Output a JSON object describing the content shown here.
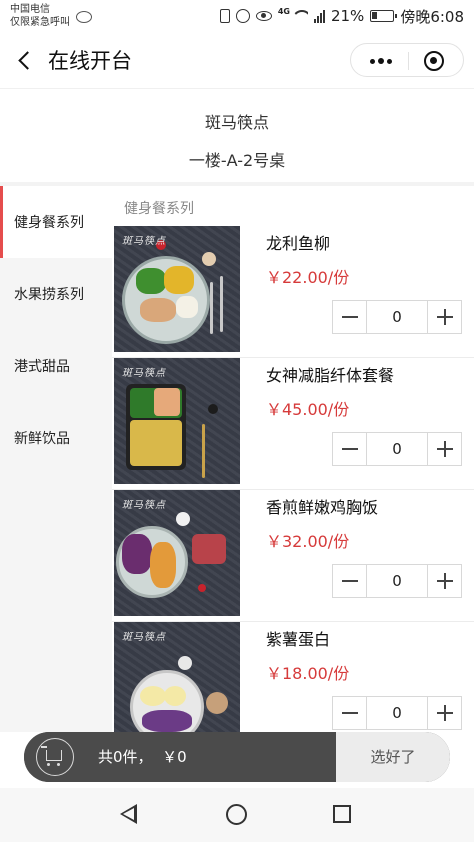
{
  "status_bar": {
    "carrier_line1": "中国电信",
    "carrier_line2": "仅限紧急呼叫",
    "network": "4G",
    "battery": "21%",
    "time": "傍晚6:08"
  },
  "navbar": {
    "title": "在线开台"
  },
  "shop": {
    "name": "斑马筷点",
    "table": "一楼-A-2号桌"
  },
  "sidebar": {
    "items": [
      {
        "label": "健身餐系列",
        "active": true
      },
      {
        "label": "水果捞系列",
        "active": false
      },
      {
        "label": "港式甜品",
        "active": false
      },
      {
        "label": "新鲜饮品",
        "active": false
      }
    ]
  },
  "content": {
    "section_title": "健身餐系列",
    "dishes": [
      {
        "name": "龙利鱼柳",
        "price": "￥22.00/份",
        "quantity": "0",
        "photo_brand": "斑马筷点"
      },
      {
        "name": "女神减脂纤体套餐",
        "price": "￥45.00/份",
        "quantity": "0",
        "photo_brand": "斑马筷点"
      },
      {
        "name": "香煎鲜嫩鸡胸饭",
        "price": "￥32.00/份",
        "quantity": "0",
        "photo_brand": "斑马筷点"
      },
      {
        "name": "紫薯蛋白",
        "price": "￥18.00/份",
        "quantity": "0",
        "photo_brand": "斑马筷点"
      }
    ]
  },
  "cart": {
    "summary": "共0件，  ￥0",
    "checkout_label": "选好了"
  },
  "colors": {
    "accent_red": "#d63a3a",
    "sidebar_active_bar": "#e54d4d",
    "cart_bar": "#4b4b4b"
  }
}
